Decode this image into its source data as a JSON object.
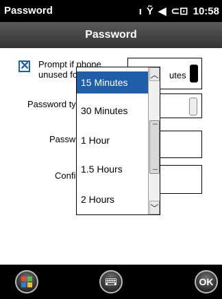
{
  "status": {
    "app_title": "Password",
    "time": "10:58"
  },
  "header": {
    "title": "Password"
  },
  "form": {
    "prompt_label_line1": "Prompt if phone",
    "prompt_label_line2": "unused fo",
    "prompt_value": "utes",
    "password_type_label": "Password ty",
    "password_label": "Passw",
    "confirm_label": "Confi"
  },
  "dropdown": {
    "items": [
      "15 Minutes",
      "30 Minutes",
      "1 Hour",
      "1.5 Hours",
      "2 Hours"
    ],
    "selected_index": 0
  },
  "bottom": {
    "ok_label": "OK"
  }
}
